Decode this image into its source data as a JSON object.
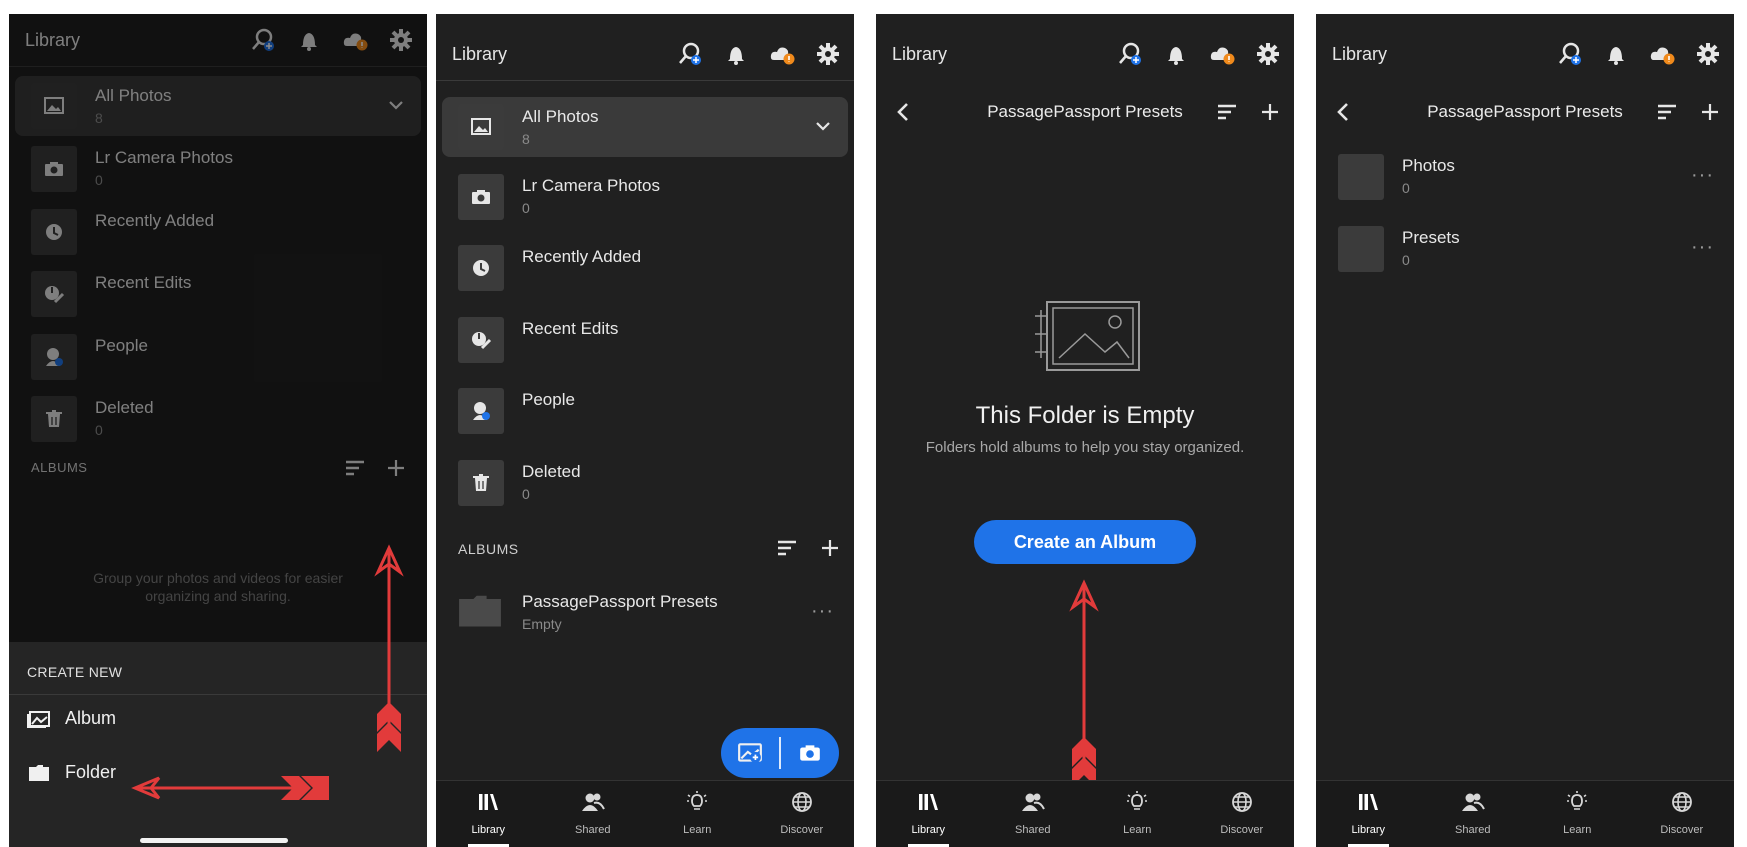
{
  "colors": {
    "accent": "#1f73e8",
    "background": "#202020",
    "annotation_arrow": "#e23b3b"
  },
  "top_bar": {
    "title": "Library",
    "icons": [
      "search-people-icon",
      "bell-icon",
      "cloud-sync-icon",
      "gear-icon"
    ]
  },
  "screen1": {
    "rows": [
      {
        "name": "All Photos",
        "count": "8"
      },
      {
        "name": "Lr Camera Photos",
        "count": "0"
      },
      {
        "name": "Recently Added",
        "count": ""
      },
      {
        "name": "Recent Edits",
        "count": ""
      },
      {
        "name": "People",
        "count": ""
      },
      {
        "name": "Deleted",
        "count": "0"
      }
    ],
    "albums_header": "ALBUMS",
    "empty_albums_text": "Group your photos and videos for easier organizing and sharing.",
    "sheet": {
      "header": "CREATE NEW",
      "album_label": "Album",
      "folder_label": "Folder"
    }
  },
  "screen2": {
    "rows": [
      {
        "name": "All Photos",
        "count": "8"
      },
      {
        "name": "Lr Camera Photos",
        "count": "0"
      },
      {
        "name": "Recently Added",
        "count": ""
      },
      {
        "name": "Recent Edits",
        "count": ""
      },
      {
        "name": "People",
        "count": ""
      },
      {
        "name": "Deleted",
        "count": "0"
      }
    ],
    "albums_header": "ALBUMS",
    "folder": {
      "name": "PassagePassport Presets",
      "status": "Empty",
      "more": "···"
    }
  },
  "screen3": {
    "header_title": "PassagePassport Presets",
    "empty_title": "This Folder is Empty",
    "empty_subtitle": "Folders hold albums to help you stay organized.",
    "cta_label": "Create an Album"
  },
  "screen4": {
    "header_title": "PassagePassport Presets",
    "albums": [
      {
        "name": "Photos",
        "count": "0",
        "more": "···"
      },
      {
        "name": "Presets",
        "count": "0",
        "more": "···"
      }
    ]
  },
  "bottom_nav": [
    {
      "label": "Library",
      "icon": "library-icon"
    },
    {
      "label": "Shared",
      "icon": "shared-people-icon"
    },
    {
      "label": "Learn",
      "icon": "lightbulb-icon"
    },
    {
      "label": "Discover",
      "icon": "globe-icon"
    }
  ]
}
